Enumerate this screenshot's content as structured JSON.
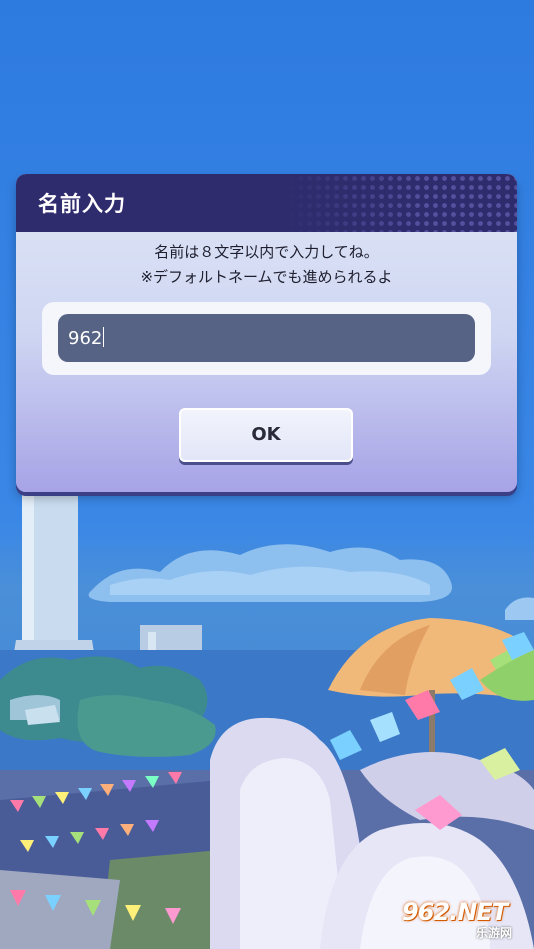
{
  "dialog": {
    "title": "名前入力",
    "instruction_line1": "名前は８文字以内で入力してね。",
    "instruction_line2": "※デフォルトネームでも進められるよ",
    "name_value": "962",
    "ok_label": "OK"
  },
  "watermark": {
    "brand": "962.NET",
    "sub": "乐游网"
  },
  "colors": {
    "sky": "#2e7be0",
    "dialog_header": "#2f2c6e",
    "input_bg": "#576384",
    "button_bg": "#eef1fb"
  }
}
